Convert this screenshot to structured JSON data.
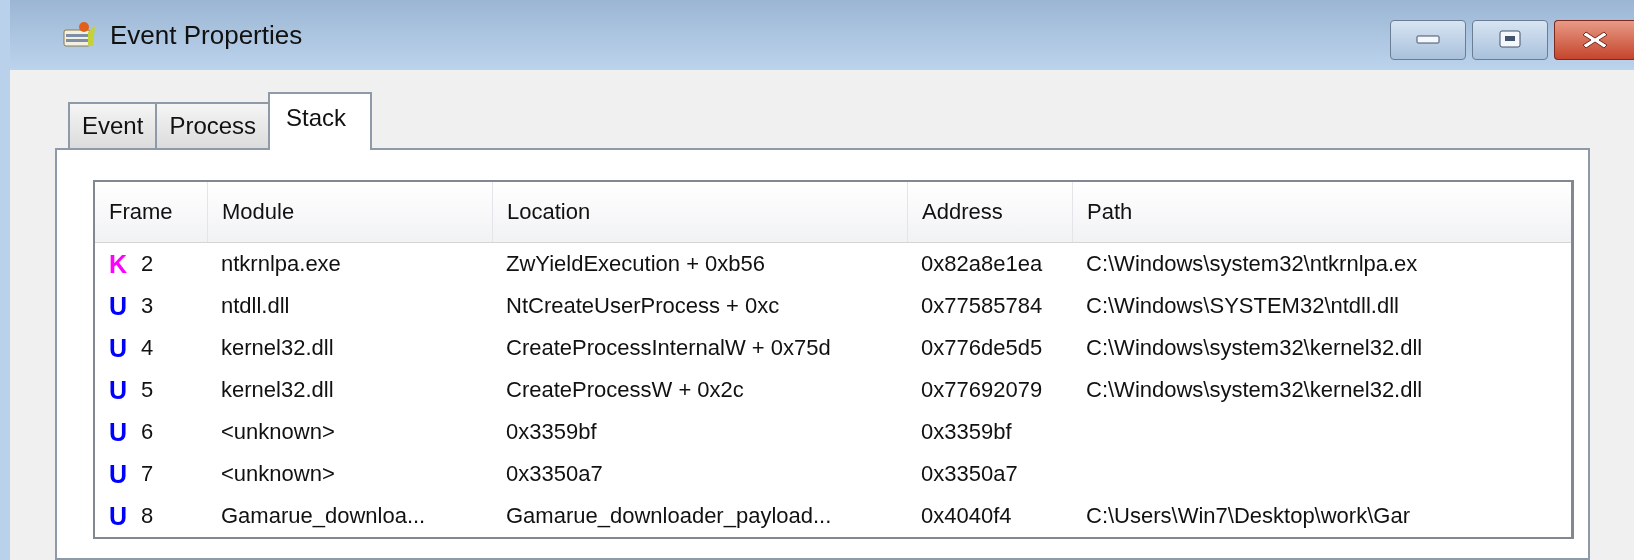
{
  "window": {
    "title": "Event Properties"
  },
  "tabs": [
    {
      "label": "Event",
      "selected": false
    },
    {
      "label": "Process",
      "selected": false
    },
    {
      "label": "Stack",
      "selected": true
    }
  ],
  "table": {
    "columns": [
      "Frame",
      "Module",
      "Location",
      "Address",
      "Path"
    ],
    "rows": [
      {
        "mode": "K",
        "color": "#ff00ff",
        "frame": "2",
        "module": "ntkrnlpa.exe",
        "location": "ZwYieldExecution + 0xb56",
        "address": "0x82a8e1ea",
        "path": "C:\\Windows\\system32\\ntkrnlpa.ex"
      },
      {
        "mode": "U",
        "color": "#0000ff",
        "frame": "3",
        "module": "ntdll.dll",
        "location": "NtCreateUserProcess + 0xc",
        "address": "0x77585784",
        "path": "C:\\Windows\\SYSTEM32\\ntdll.dll"
      },
      {
        "mode": "U",
        "color": "#0000ff",
        "frame": "4",
        "module": "kernel32.dll",
        "location": "CreateProcessInternalW + 0x75d",
        "address": "0x776de5d5",
        "path": "C:\\Windows\\system32\\kernel32.dll"
      },
      {
        "mode": "U",
        "color": "#0000ff",
        "frame": "5",
        "module": "kernel32.dll",
        "location": "CreateProcessW + 0x2c",
        "address": "0x77692079",
        "path": "C:\\Windows\\system32\\kernel32.dll"
      },
      {
        "mode": "U",
        "color": "#0000ff",
        "frame": "6",
        "module": "<unknown>",
        "location": "0x3359bf",
        "address": "0x3359bf"
      },
      {
        "mode": "U",
        "color": "#0000ff",
        "frame": "7",
        "module": "<unknown>",
        "location": "0x3350a7",
        "address": "0x3350a7"
      },
      {
        "mode": "U",
        "color": "#0000ff",
        "frame": "8",
        "module": "Gamarue_downloa...",
        "location": "Gamarue_downloader_payload...",
        "address": "0x4040f4",
        "path": "C:\\Users\\Win7\\Desktop\\work\\Gar"
      }
    ]
  }
}
